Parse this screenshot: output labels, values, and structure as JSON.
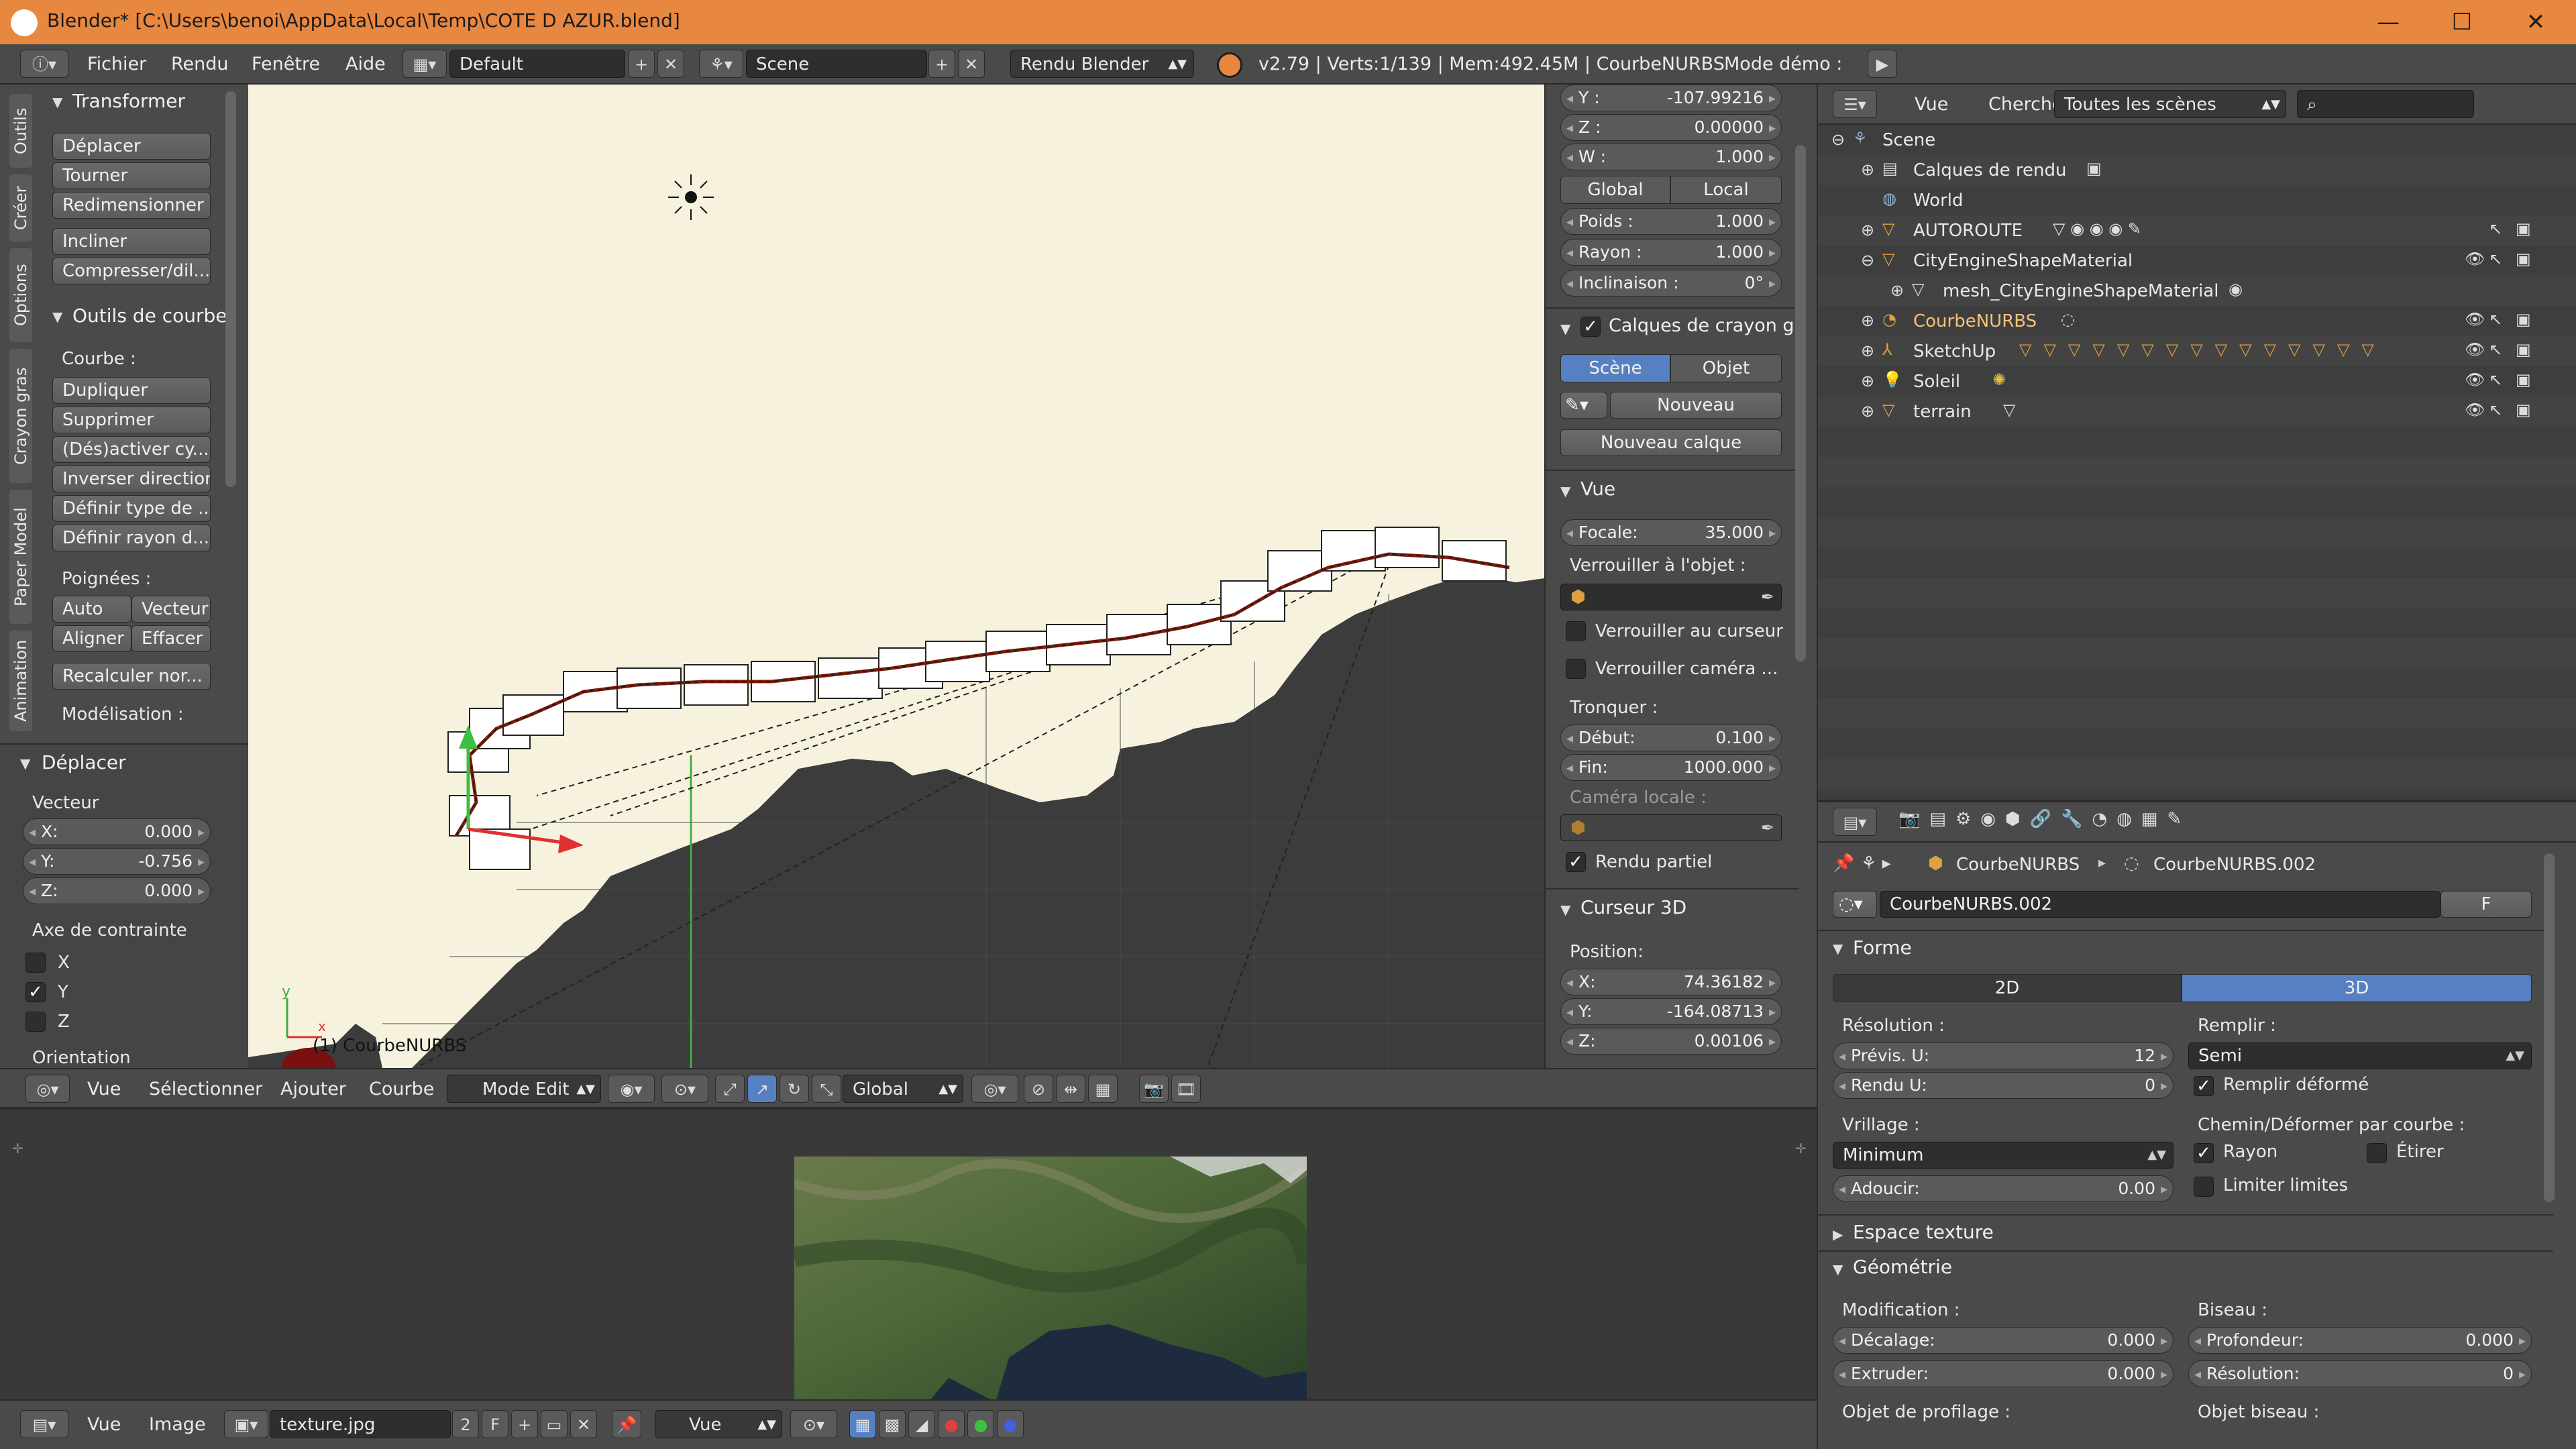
{
  "window": {
    "title": "Blender* [C:\\Users\\benoi\\AppData\\Local\\Temp\\COTE D AZUR.blend]",
    "min": "—",
    "max": "☐",
    "close": "✕"
  },
  "info_header": {
    "menus": [
      "Fichier",
      "Rendu",
      "Fenêtre",
      "Aide"
    ],
    "layout": "Default",
    "scene": "Scene",
    "engine": "Rendu Blender",
    "stats": "v2.79 | Verts:1/139 | Mem:492.45M | CourbeNURBS",
    "demo_label": "Mode démo :"
  },
  "tool_tabs": [
    "Outils",
    "Créer",
    "Options",
    "Crayon gras",
    "Paper Model",
    "Animation"
  ],
  "tools": {
    "transform_title": "Transformer",
    "transform_buttons": [
      "Déplacer",
      "Tourner",
      "Redimensionner",
      "Incliner",
      "Compresser/dil..."
    ],
    "curve_tools_title": "Outils de courbe",
    "curve_label": "Courbe :",
    "curve_buttons": [
      "Dupliquer",
      "Supprimer",
      "(Dés)activer cy...",
      "Inverser direction",
      "Définir type de ...",
      "Définir rayon d..."
    ],
    "handles_label": "Poignées :",
    "handles": [
      "Auto",
      "Vecteur",
      "Aligner",
      "Effacer"
    ],
    "recalc": "Recalculer nor...",
    "modeling_label": "Modélisation :",
    "move_title": "Déplacer",
    "vector_label": "Vecteur",
    "vector": [
      {
        "k": "X:",
        "v": "0.000"
      },
      {
        "k": "Y:",
        "v": "-0.756"
      },
      {
        "k": "Z:",
        "v": "0.000"
      }
    ],
    "constraint_label": "Axe de contrainte",
    "constraints": [
      {
        "k": "X",
        "checked": ""
      },
      {
        "k": "Y",
        "checked": "✓"
      },
      {
        "k": "Z",
        "checked": ""
      }
    ],
    "orientation_label": "Orientation"
  },
  "viewport": {
    "object_label": "(1) CourbeNURBS",
    "axis_y": "y",
    "axis_x": "x"
  },
  "viewport_header": {
    "menus": [
      "Vue",
      "Sélectionner",
      "Ajouter",
      "Courbe"
    ],
    "mode": "Mode Edit",
    "orientation": "Global"
  },
  "props_n": {
    "coords": [
      {
        "k": "Y :",
        "v": "-107.99216"
      },
      {
        "k": "Z :",
        "v": "0.00000"
      },
      {
        "k": "W :",
        "v": "1.000"
      }
    ],
    "global": "Global",
    "local": "Local",
    "weights": [
      {
        "k": "Poids :",
        "v": "1.000"
      },
      {
        "k": "Rayon :",
        "v": "1.000"
      },
      {
        "k": "Inclinaison :",
        "v": "0°"
      }
    ],
    "gp_title": "Calques de crayon g",
    "scene_btn": "Scène",
    "object_btn": "Objet",
    "new_btn": "Nouveau",
    "new_layer_btn": "Nouveau calque",
    "view_title": "Vue",
    "focal": {
      "k": "Focale:",
      "v": "35.000"
    },
    "lock_obj_label": "Verrouiller à l'objet :",
    "lock_cursor": "Verrouiller au curseur",
    "lock_camera": "Verrouiller caméra ...",
    "clip_label": "Tronquer :",
    "clip_start": {
      "k": "Début:",
      "v": "0.100"
    },
    "clip_end": {
      "k": "Fin:",
      "v": "1000.000"
    },
    "local_cam": "Caméra locale :",
    "partial_render": "Rendu partiel",
    "cursor_title": "Curseur 3D",
    "position_label": "Position:",
    "cursor": [
      {
        "k": "X:",
        "v": "74.36182"
      },
      {
        "k": "Y:",
        "v": "-164.08713"
      },
      {
        "k": "Z:",
        "v": "0.00106"
      }
    ]
  },
  "outliner": {
    "menus": [
      "Vue",
      "Chercher"
    ],
    "filter": "Toutes les scènes",
    "items": [
      {
        "name": "Scene",
        "depth": 0
      },
      {
        "name": "Calques de rendu",
        "depth": 1
      },
      {
        "name": "World",
        "depth": 1
      },
      {
        "name": "AUTOROUTE",
        "depth": 1
      },
      {
        "name": "CityEngineShapeMaterial",
        "depth": 1
      },
      {
        "name": "mesh_CityEngineShapeMaterial",
        "depth": 2
      },
      {
        "name": "CourbeNURBS",
        "depth": 1
      },
      {
        "name": "SketchUp",
        "depth": 1
      },
      {
        "name": "Soleil",
        "depth": 1
      },
      {
        "name": "terrain",
        "depth": 1
      }
    ]
  },
  "properties": {
    "breadcrumb_obj": "CourbeNURBS",
    "breadcrumb_data": "CourbeNURBS.002",
    "datablock": "CourbeNURBS.002",
    "fake_user": "F",
    "shape_title": "Forme",
    "mode_2d": "2D",
    "mode_3d": "3D",
    "resolution_label": "Résolution :",
    "preview_u": {
      "k": "Prévis. U:",
      "v": "12"
    },
    "render_u": {
      "k": "Rendu U:",
      "v": "0"
    },
    "fill_label": "Remplir :",
    "fill_value": "Semi",
    "fill_deformed": "Remplir déformé",
    "twist_label": "Vrillage :",
    "twist_value": "Minimum",
    "path_label": "Chemin/Déformer par courbe :",
    "radius": "Rayon",
    "stretch": "Étirer",
    "smooth": {
      "k": "Adoucir:",
      "v": "0.00"
    },
    "bounds": "Limiter limites",
    "texspace_title": "Espace texture",
    "geometry_title": "Géométrie",
    "modification_label": "Modification :",
    "bevel_label": "Biseau :",
    "offset": {
      "k": "Décalage:",
      "v": "0.000"
    },
    "extrude": {
      "k": "Extruder:",
      "v": "0.000"
    },
    "depth": {
      "k": "Profondeur:",
      "v": "0.000"
    },
    "bevel_res": {
      "k": "Résolution:",
      "v": "0"
    },
    "taper_label": "Objet de profilage :",
    "bevel_obj_label": "Objet biseau :"
  },
  "image_editor": {
    "menus": [
      "Vue",
      "Image"
    ],
    "image_name": "texture.jpg",
    "users": "2",
    "fake": "F",
    "view_mode": "Vue"
  }
}
